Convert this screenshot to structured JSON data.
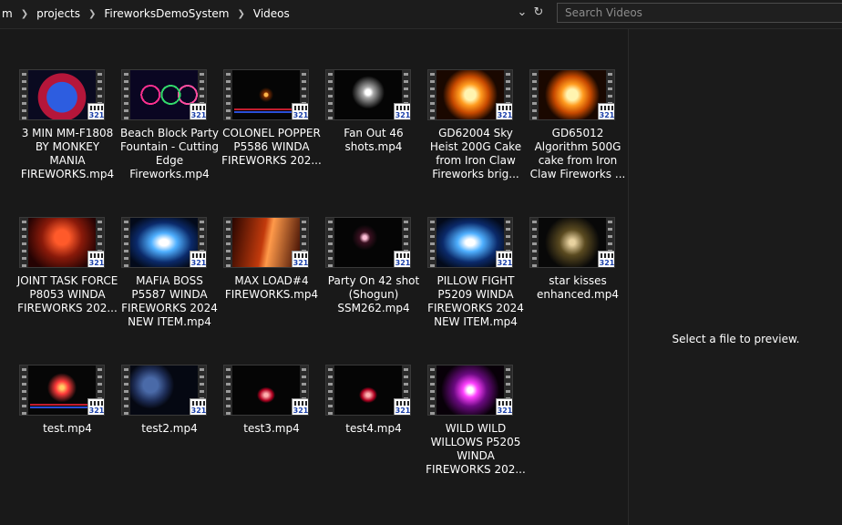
{
  "address": {
    "crumbs": [
      "m",
      "projects",
      "FireworksDemoSystem",
      "Videos"
    ],
    "search_placeholder": "Search Videos"
  },
  "preview": {
    "message": "Select a file to preview."
  },
  "files": [
    {
      "name": "3 MIN MM-F1808 BY MONKEY MANIA FIREWORKS.mp4",
      "thumb": "f-box"
    },
    {
      "name": "Beach Block Party Fountain - Cutting Edge Fireworks.mp4",
      "thumb": "f-rings"
    },
    {
      "name": "COLONEL POPPER P5586 WINDA FIREWORKS 202...",
      "thumb": "f-spark"
    },
    {
      "name": "Fan Out 46 shots.mp4",
      "thumb": "f-burst"
    },
    {
      "name": "GD62004 Sky Heist 200G Cake from Iron Claw Fireworks brig...",
      "thumb": "f-fire"
    },
    {
      "name": "GD65012 Algorithm 500G cake from Iron Claw Fireworks ...",
      "thumb": "f-fire"
    },
    {
      "name": "JOINT TASK FORCE P8053 WINDA FIREWORKS 202...",
      "thumb": "f-red"
    },
    {
      "name": "MAFIA BOSS P5587 WINDA FIREWORKS 2024 NEW ITEM.mp4",
      "thumb": "f-blue"
    },
    {
      "name": "MAX LOAD#4 FIREWORKS.mp4",
      "thumb": "f-orange"
    },
    {
      "name": "Party On 42 shot (Shogun) SSM262.mp4",
      "thumb": "f-party"
    },
    {
      "name": "PILLOW FIGHT P5209 WINDA FIREWORKS 2024 NEW ITEM.mp4",
      "thumb": "f-blue"
    },
    {
      "name": "star kisses enhanced.mp4",
      "thumb": "f-gold"
    },
    {
      "name": "test.mp4",
      "thumb": "f-test"
    },
    {
      "name": "test2.mp4",
      "thumb": "f-earth"
    },
    {
      "name": "test3.mp4",
      "thumb": "f-bowl"
    },
    {
      "name": "test4.mp4",
      "thumb": "f-bowl"
    },
    {
      "name": "WILD WILD WILLOWS P5205 WINDA FIREWORKS 202...",
      "thumb": "f-purple"
    }
  ],
  "badge_text": "321"
}
